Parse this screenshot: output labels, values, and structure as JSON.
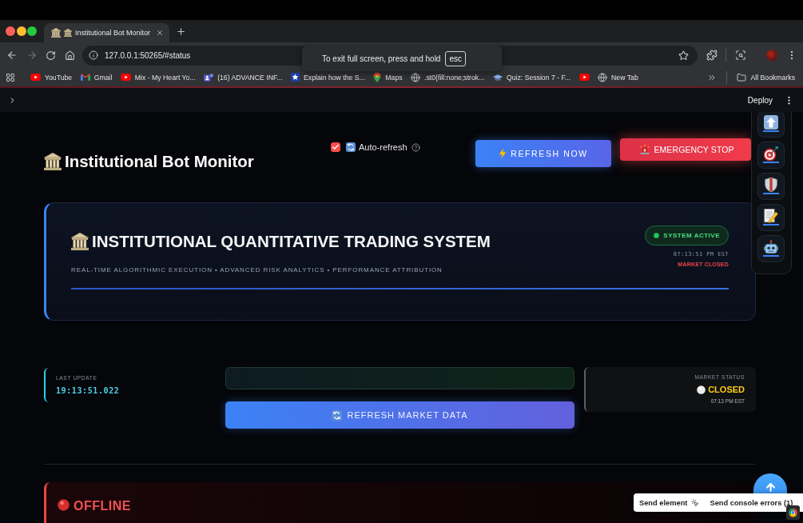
{
  "browser": {
    "tabs": [
      {
        "title": "Institutional Bot Monitor",
        "selected": true
      }
    ],
    "address": "127.0.0.1:50265/#status",
    "fullscreen_notice": {
      "text": "To exit full screen, press and hold",
      "key": "esc"
    },
    "bookmarks": [
      {
        "kind": "youtube",
        "label": "YouTube"
      },
      {
        "kind": "gmail",
        "label": "Gmail"
      },
      {
        "kind": "youtube",
        "label": "Mix - My Heart Yo..."
      },
      {
        "kind": "teams",
        "label": "(16) ADVANCE INF..."
      },
      {
        "kind": "star",
        "label": "Explain how the S..."
      },
      {
        "kind": "maps",
        "label": "Maps"
      },
      {
        "kind": "globe",
        "label": ".st0{fill:none;strok..."
      },
      {
        "kind": "quiz",
        "label": "Quiz: Session 7 - F..."
      },
      {
        "kind": "youtube"
      },
      {
        "kind": "globe",
        "label": "New Tab"
      }
    ],
    "all_bookmarks": "All Bookmarks"
  },
  "app_header": {
    "deploy": "Deploy"
  },
  "page": {
    "title": "Institutional Bot Monitor",
    "auto_refresh": {
      "label": "Auto-refresh",
      "checked": true
    },
    "refresh_button": "REFRESH NOW",
    "emergency_button": "EMERGENCY STOP",
    "side_toolbar": [
      {
        "kind": "up_arrow"
      },
      {
        "kind": "target"
      },
      {
        "kind": "shield"
      },
      {
        "kind": "memo"
      },
      {
        "kind": "robot"
      }
    ],
    "hero": {
      "title": "INSTITUTIONAL QUANTITATIVE TRADING SYSTEM",
      "subtitle": "REAL-TIME ALGORITHMIC EXECUTION • ADVANCED RISK ANALYTICS • PERFORMANCE ATTRIBUTION",
      "status": "SYSTEM ACTIVE",
      "clock": "07:13:51 PM EST",
      "market": "MARKET CLOSED"
    },
    "last_update": {
      "label": "LAST UPDATE",
      "value": "19:13:51.022"
    },
    "refresh_market_button": "REFRESH MARKET DATA",
    "market_status": {
      "label": "MARKET STATUS",
      "value": "CLOSED",
      "time": "07:13 PM EST"
    },
    "bot_status": {
      "label": "OFFLINE"
    }
  },
  "dev_toolbar": {
    "send_element": "Send element",
    "send_console_errors": "Send console errors (1)"
  }
}
